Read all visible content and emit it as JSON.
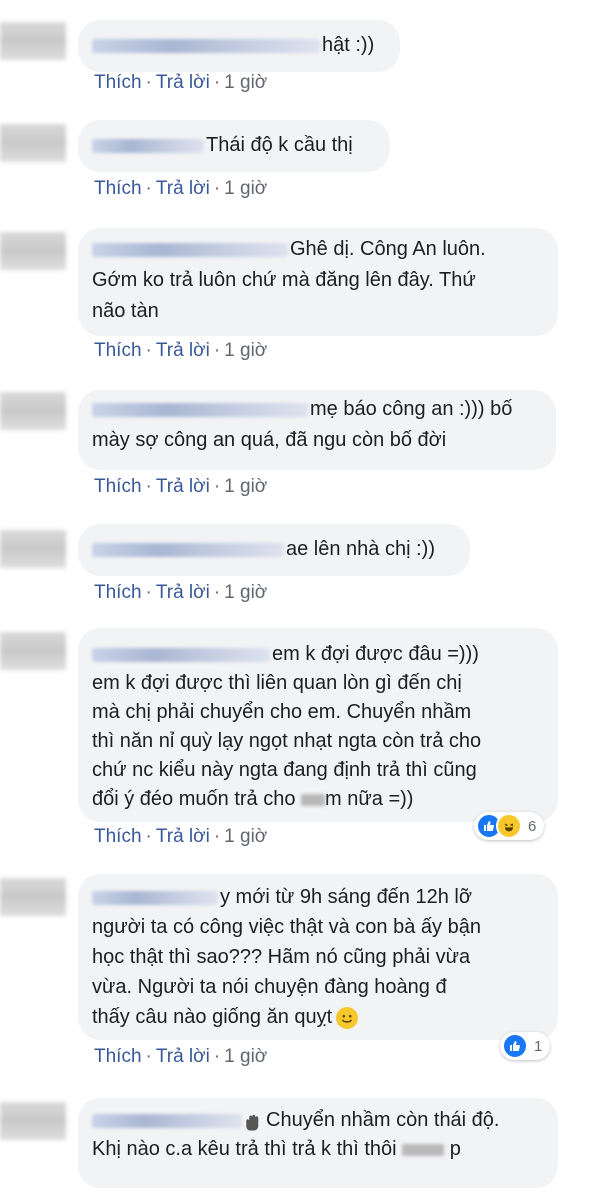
{
  "actions": {
    "like": "Thích",
    "reply": "Trả lời",
    "sep": "·",
    "time": "1 giờ"
  },
  "comments": [
    {
      "text": "hật :))"
    },
    {
      "text": "Thái độ k cầu thị"
    },
    {
      "lines": [
        "Ghê dị. Công An luôn.",
        "Gớm ko trả luôn chứ mà đăng lên đây. Thứ",
        "não tàn"
      ]
    },
    {
      "lines": [
        "mẹ báo công an :))) bố",
        "mày sợ công an quá, đã ngu còn bố đời"
      ]
    },
    {
      "text": "ae lên nhà chị :))"
    },
    {
      "lines": [
        "em k đợi được đâu =)))",
        "em k đợi được thì liên quan lòn gì đến chị",
        "mà chị phải chuyển cho em. Chuyển nhầm",
        "thì năn nỉ quỳ lạy ngọt nhạt ngta còn trả cho",
        "chứ nc kiểu này ngta đang định trả thì cũng",
        "đổi ý đéo muốn trả cho",
        "m nữa =))"
      ],
      "reactions": {
        "count": "6",
        "icons": [
          "like-icon",
          "haha-icon"
        ]
      }
    },
    {
      "lines": [
        "y mới từ 9h sáng đến 12h lỡ",
        "người ta có công việc thật và con bà ấy bận",
        "học thật thì sao??? Hãm nó cũng phải vừa",
        "vừa. Người ta nói chuyện đàng hoàng đ",
        "thấy câu nào giống ăn quỵt"
      ],
      "reactions": {
        "count": "1",
        "icons": [
          "like-icon"
        ]
      }
    },
    {
      "lines": [
        "Chuyển nhầm còn thái độ.",
        "Khị nào c.a kêu trả thì trả k thì thôi",
        "p"
      ]
    }
  ],
  "colors": {
    "bubble": "#f2f3f5",
    "link": "#385898",
    "meta": "#606770",
    "like": "#1877f2",
    "haha": "#f7c82b"
  }
}
